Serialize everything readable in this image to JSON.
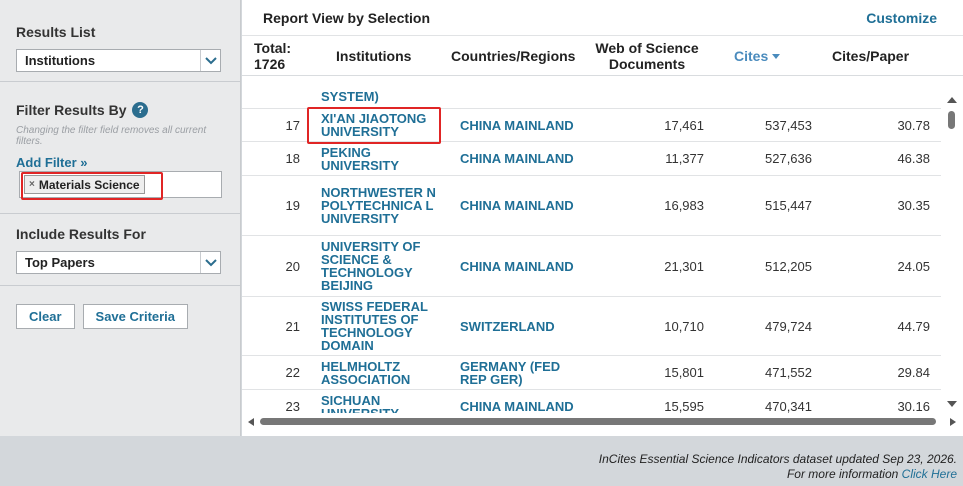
{
  "sidebar": {
    "results_list": {
      "title": "Results List",
      "selected": "Institutions"
    },
    "filter": {
      "title": "Filter Results By",
      "note": "Changing the filter field removes all current filters.",
      "add_filter_label": "Add Filter »",
      "chip_label": "Materials Science",
      "chip_remove": "×"
    },
    "include": {
      "title": "Include Results For",
      "selected": "Top Papers"
    },
    "buttons": {
      "clear": "Clear",
      "save": "Save Criteria"
    }
  },
  "main": {
    "title": "Report View by Selection",
    "customize_label": "Customize",
    "columns": {
      "total_label": "Total:",
      "total_value": "1726",
      "institutions": "Institutions",
      "countries": "Countries/Regions",
      "wos_docs_line1": "Web of Science",
      "wos_docs_line2": "Documents",
      "cites": "Cites",
      "cites_per_paper": "Cites/Paper"
    },
    "partial_row_text": "SYSTEM)",
    "rows": [
      {
        "rank": "17",
        "institution": "XI'AN JIAOTONG UNIVERSITY",
        "country": "CHINA MAINLAND",
        "docs": "17,461",
        "cites": "537,453",
        "cpp": "30.78"
      },
      {
        "rank": "18",
        "institution": "PEKING UNIVERSITY",
        "country": "CHINA MAINLAND",
        "docs": "11,377",
        "cites": "527,636",
        "cpp": "46.38"
      },
      {
        "rank": "19",
        "institution": "NORTHWESTER N POLYTECHNICA L UNIVERSITY",
        "country": "CHINA MAINLAND",
        "docs": "16,983",
        "cites": "515,447",
        "cpp": "30.35"
      },
      {
        "rank": "20",
        "institution": "UNIVERSITY OF SCIENCE & TECHNOLOGY BEIJING",
        "country": "CHINA MAINLAND",
        "docs": "21,301",
        "cites": "512,205",
        "cpp": "24.05"
      },
      {
        "rank": "21",
        "institution": "SWISS FEDERAL INSTITUTES OF TECHNOLOGY DOMAIN",
        "country": "SWITZERLAND",
        "docs": "10,710",
        "cites": "479,724",
        "cpp": "44.79"
      },
      {
        "rank": "22",
        "institution": "HELMHOLTZ ASSOCIATION",
        "country": "GERMANY (FED REP GER)",
        "docs": "15,801",
        "cites": "471,552",
        "cpp": "29.84"
      },
      {
        "rank": "23",
        "institution": "SICHUAN UNIVERSITY",
        "country": "CHINA MAINLAND",
        "docs": "15,595",
        "cites": "470,341",
        "cpp": "30.16"
      }
    ]
  },
  "footer": {
    "line1": "InCites Essential Science Indicators dataset updated Sep 23, 2026.",
    "line2_prefix": "For more information",
    "link": "Click Here"
  },
  "colors": {
    "accent": "#1f6f96",
    "highlight": "#e02525",
    "sort_header": "#4a8bbd"
  }
}
